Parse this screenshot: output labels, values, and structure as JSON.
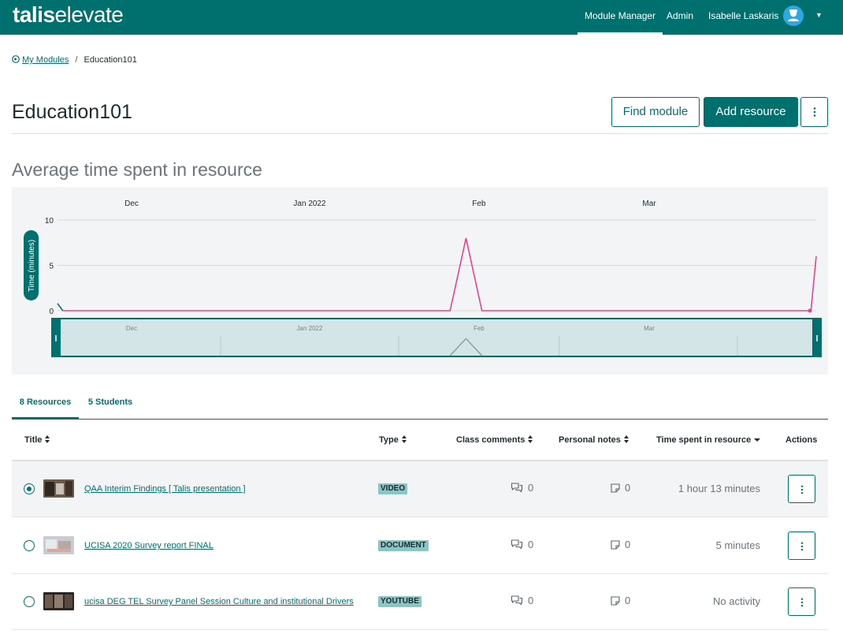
{
  "app": {
    "logo_main": "talis",
    "logo_sub": "elevate"
  },
  "nav": {
    "items": [
      {
        "label": "Module Manager"
      },
      {
        "label": "Admin"
      },
      {
        "label": "Isabelle Laskaris"
      }
    ],
    "active": "Module Manager",
    "avatar_icon": "user-avatar-icon"
  },
  "breadcrumb": {
    "back_label": "My Modules",
    "separator": "/",
    "current": "Education101"
  },
  "page": {
    "title": "Education101",
    "find_button": "Find module",
    "add_button": "Add resource",
    "more_icon": "vertical-dots-icon"
  },
  "chart_section": {
    "title": "Average time spent in resource"
  },
  "chart_data": {
    "type": "line",
    "title": "Average time spent in resource",
    "xlabel": "",
    "ylabel": "Time (minutes)",
    "x_tick_labels": [
      "Dec",
      "Jan 2022",
      "Feb",
      "Mar"
    ],
    "y_tick_labels": [
      "10",
      "5",
      "0"
    ],
    "ylim": [
      0,
      10
    ],
    "grid": true,
    "series": [
      {
        "color": "#00706e",
        "x": [
          "2021-11-09",
          "2021-11-10"
        ],
        "values": [
          0.8,
          0
        ]
      },
      {
        "color": "#e8418f",
        "x": [
          "2021-11-10",
          "2022-01-22",
          "2022-01-25",
          "2022-01-28",
          "2022-03-31",
          "2022-04-01"
        ],
        "values": [
          0,
          0,
          8,
          0,
          0,
          6
        ]
      }
    ],
    "navigator": {
      "tick_labels": [
        "Dec",
        "Jan 2022",
        "Feb",
        "Mar"
      ]
    },
    "colors": {
      "teal": "#00706e",
      "pink": "#e8418f"
    }
  },
  "tabs": [
    {
      "label": "8 Resources",
      "active": true
    },
    {
      "label": "5 Students",
      "active": false
    }
  ],
  "table": {
    "headers": {
      "title": "Title",
      "type": "Type",
      "comments": "Class comments",
      "notes": "Personal notes",
      "time": "Time spent in resource",
      "actions": "Actions"
    },
    "rows": [
      {
        "title": "QAA Interim Findings [ Talis presentation ]",
        "type": "VIDEO",
        "comments": "0",
        "notes": "0",
        "time": "1 hour 13 minutes",
        "selected": true
      },
      {
        "title": "UCISA 2020 Survey report FINAL",
        "type": "DOCUMENT",
        "comments": "0",
        "notes": "0",
        "time": "5 minutes",
        "selected": false
      },
      {
        "title": "ucisa DEG TEL Survey Panel Session Culture and institutional Drivers",
        "type": "YOUTUBE",
        "comments": "0",
        "notes": "0",
        "time": "No activity",
        "selected": false
      }
    ]
  }
}
